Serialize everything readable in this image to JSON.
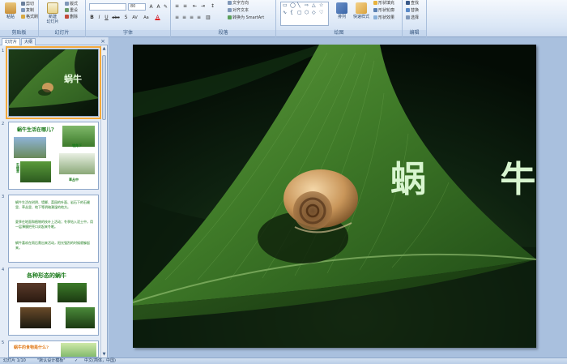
{
  "ribbon": {
    "clipboard": {
      "paste": "粘贴",
      "cut": "剪切",
      "copy": "复制",
      "format_painter": "格式刷",
      "label": "剪贴板"
    },
    "slides": {
      "new_slide": "新建\n幻灯片",
      "layout": "版式",
      "reset": "重设",
      "delete": "删除",
      "label": "幻灯片"
    },
    "font": {
      "font_name": "",
      "font_size": "80",
      "bold": "B",
      "italic": "I",
      "underline": "U",
      "strike": "abe",
      "shadow": "S",
      "spacing": "AV",
      "case": "Aa",
      "color": "A",
      "label": "字体"
    },
    "paragraph": {
      "text_direction": "文字方向",
      "align_text": "对齐文本",
      "smartart": "转换为 SmartArt",
      "label": "段落"
    },
    "drawing": {
      "arrange": "排列",
      "quick_styles": "快速样式",
      "shape_fill": "形状填充",
      "shape_outline": "形状轮廓",
      "shape_effects": "形状效果",
      "label": "绘图"
    },
    "editing": {
      "find": "查找",
      "replace": "替换",
      "select": "选择",
      "label": "编辑"
    }
  },
  "panel": {
    "tab_slides": "幻灯片",
    "tab_outline": "大纲",
    "close": "×",
    "slides": [
      {
        "number": "1",
        "title": "蜗牛"
      },
      {
        "number": "2",
        "title": "蜗牛生活在哪儿?",
        "captions": [
          "墙角下",
          "石缝里",
          "草丛中"
        ]
      },
      {
        "number": "3",
        "paragraphs": [
          "蜗牛生活在树阴、墙脚、菜园的叶面、岩石下的石缝里、草丛里、地下等阴暗潮湿的地方。",
          "夏季在地面和植物的枝叶上活动；冬季钻入泥土中，用一层薄膜把壳口封起来冬眠。",
          "蜗牛喜欢在雨后爬出来活动，阳光强烈的时候就躲起来。"
        ]
      },
      {
        "number": "4",
        "title": "各种形态的蜗牛"
      },
      {
        "number": "5",
        "title": "蜗牛的食物是什么?"
      }
    ]
  },
  "slide_main": {
    "title": "蜗  牛"
  },
  "status": {
    "slide_info": "幻灯片 1/10",
    "theme": "\"默认设计模板\"",
    "language": "中文(简体，中国)"
  },
  "colors": {
    "accent": "#2a5ea8",
    "title_light_green": "#d8f5cf",
    "thumb_green": "#1a7a1a",
    "selection": "#f3a93c"
  }
}
